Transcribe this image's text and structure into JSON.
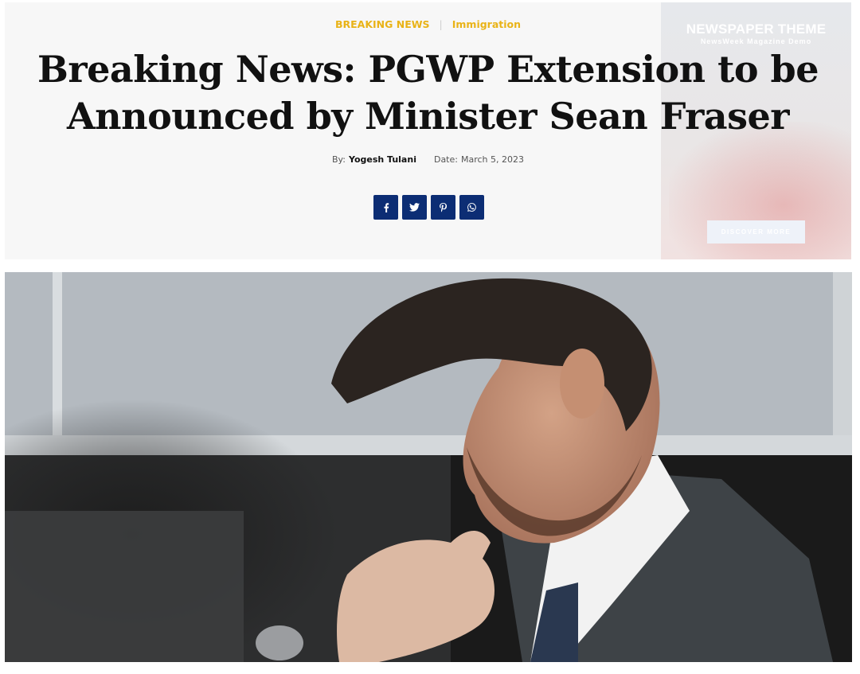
{
  "article": {
    "categories": [
      "BREAKING NEWS",
      "Immigration"
    ],
    "title": "Breaking News: PGWP Extension to be Announced by Minister Sean Fraser",
    "by_label": "By:",
    "author": "Yogesh Tulani",
    "date_label": "Date:",
    "date": "March 5, 2023"
  },
  "share": {
    "icons": [
      "facebook-icon",
      "twitter-icon",
      "pinterest-icon",
      "whatsapp-icon"
    ],
    "color": "#0c2d74"
  },
  "promo": {
    "title": "NEWSPAPER THEME",
    "subtitle": "NewsWeek Magazine Demo",
    "button": "DISCOVER MORE"
  },
  "colors": {
    "category": "#e9b317",
    "panel_bg": "#f7f7f7",
    "title": "#111111"
  }
}
